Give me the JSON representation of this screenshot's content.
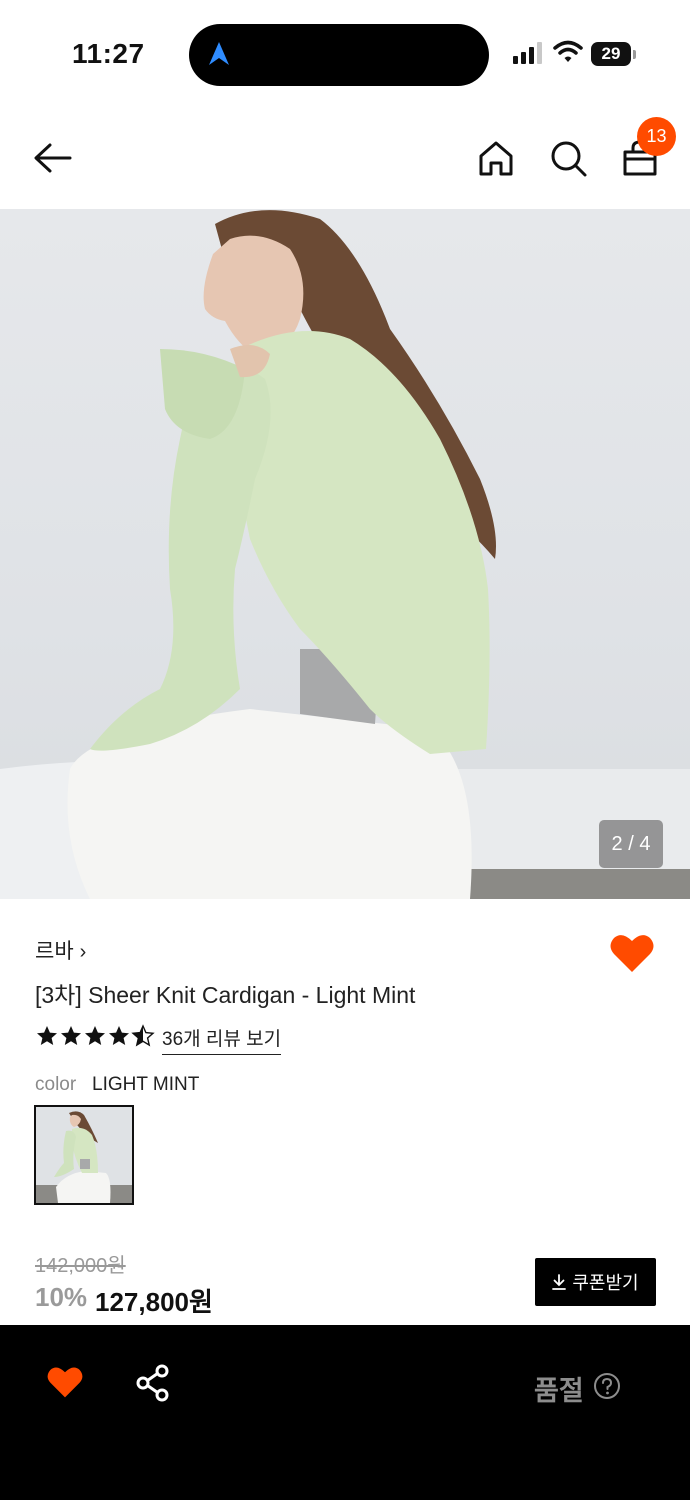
{
  "status_bar": {
    "time": "11:27",
    "battery": "29"
  },
  "header": {
    "cart_count": "13"
  },
  "gallery": {
    "counter": "2 / 4"
  },
  "product": {
    "brand": "르바",
    "brand_chevron": "›",
    "title": "[3차] Sheer Knit Cardigan - Light Mint",
    "rating": 4.5,
    "review_link": "36개 리뷰 보기",
    "color_label": "color",
    "color_value": "LIGHT MINT",
    "original_price": "142,000원",
    "discount": "10%",
    "final_price": "127,800원",
    "coupon_button": "쿠폰받기"
  },
  "bottom_bar": {
    "status": "품절"
  },
  "colors": {
    "accent": "#ff4b00",
    "dark": "#000000",
    "muted": "#8d8d8d"
  }
}
